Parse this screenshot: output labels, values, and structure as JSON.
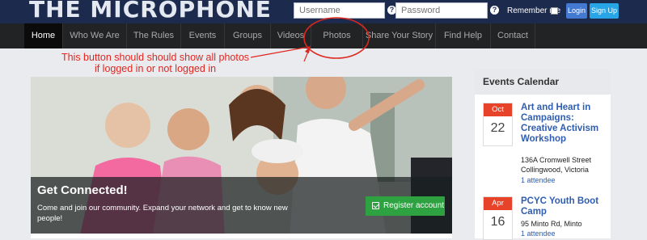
{
  "header": {
    "logo": "THE MICROPHONE",
    "username_placeholder": "Username",
    "password_placeholder": "Password",
    "help_glyph": "?",
    "remember_label": "Remember me",
    "login_label": "Login",
    "signup_label": "Sign Up"
  },
  "nav": {
    "items": [
      {
        "label": "Home",
        "active": true
      },
      {
        "label": "Who We Are"
      },
      {
        "label": "The Rules"
      },
      {
        "label": "Events"
      },
      {
        "label": "Groups"
      },
      {
        "label": "Videos"
      },
      {
        "label": "Photos"
      },
      {
        "label": "Share Your Story"
      },
      {
        "label": "Find Help"
      },
      {
        "label": "Contact"
      }
    ]
  },
  "annotation": {
    "line1": "This button should should show all photos",
    "line2": "if logged in or not logged in",
    "color": "#e0261f"
  },
  "hero": {
    "title": "Get Connected!",
    "description": "Come and join our community. Expand your network and get to know new people!",
    "register_label": "Register account",
    "register_icon": "checkbox-icon"
  },
  "events": {
    "heading": "Events Calendar",
    "items": [
      {
        "month": "Oct",
        "day": "22",
        "title": "Art and Heart in Campaigns: Creative Activism Workshop",
        "location": "136A Cromwell Street Collingwood, Victoria",
        "attendees": "1 attendee"
      },
      {
        "month": "Apr",
        "day": "16",
        "title": "PCYC Youth Boot Camp",
        "location": "95 Minto Rd, Minto",
        "attendees": "1 attendee"
      }
    ]
  },
  "colors": {
    "header_bg": "#1c2b4d",
    "nav_bg": "#222325",
    "link": "#2f5db0",
    "date_red": "#e7432b",
    "register_green": "#2ea140"
  }
}
